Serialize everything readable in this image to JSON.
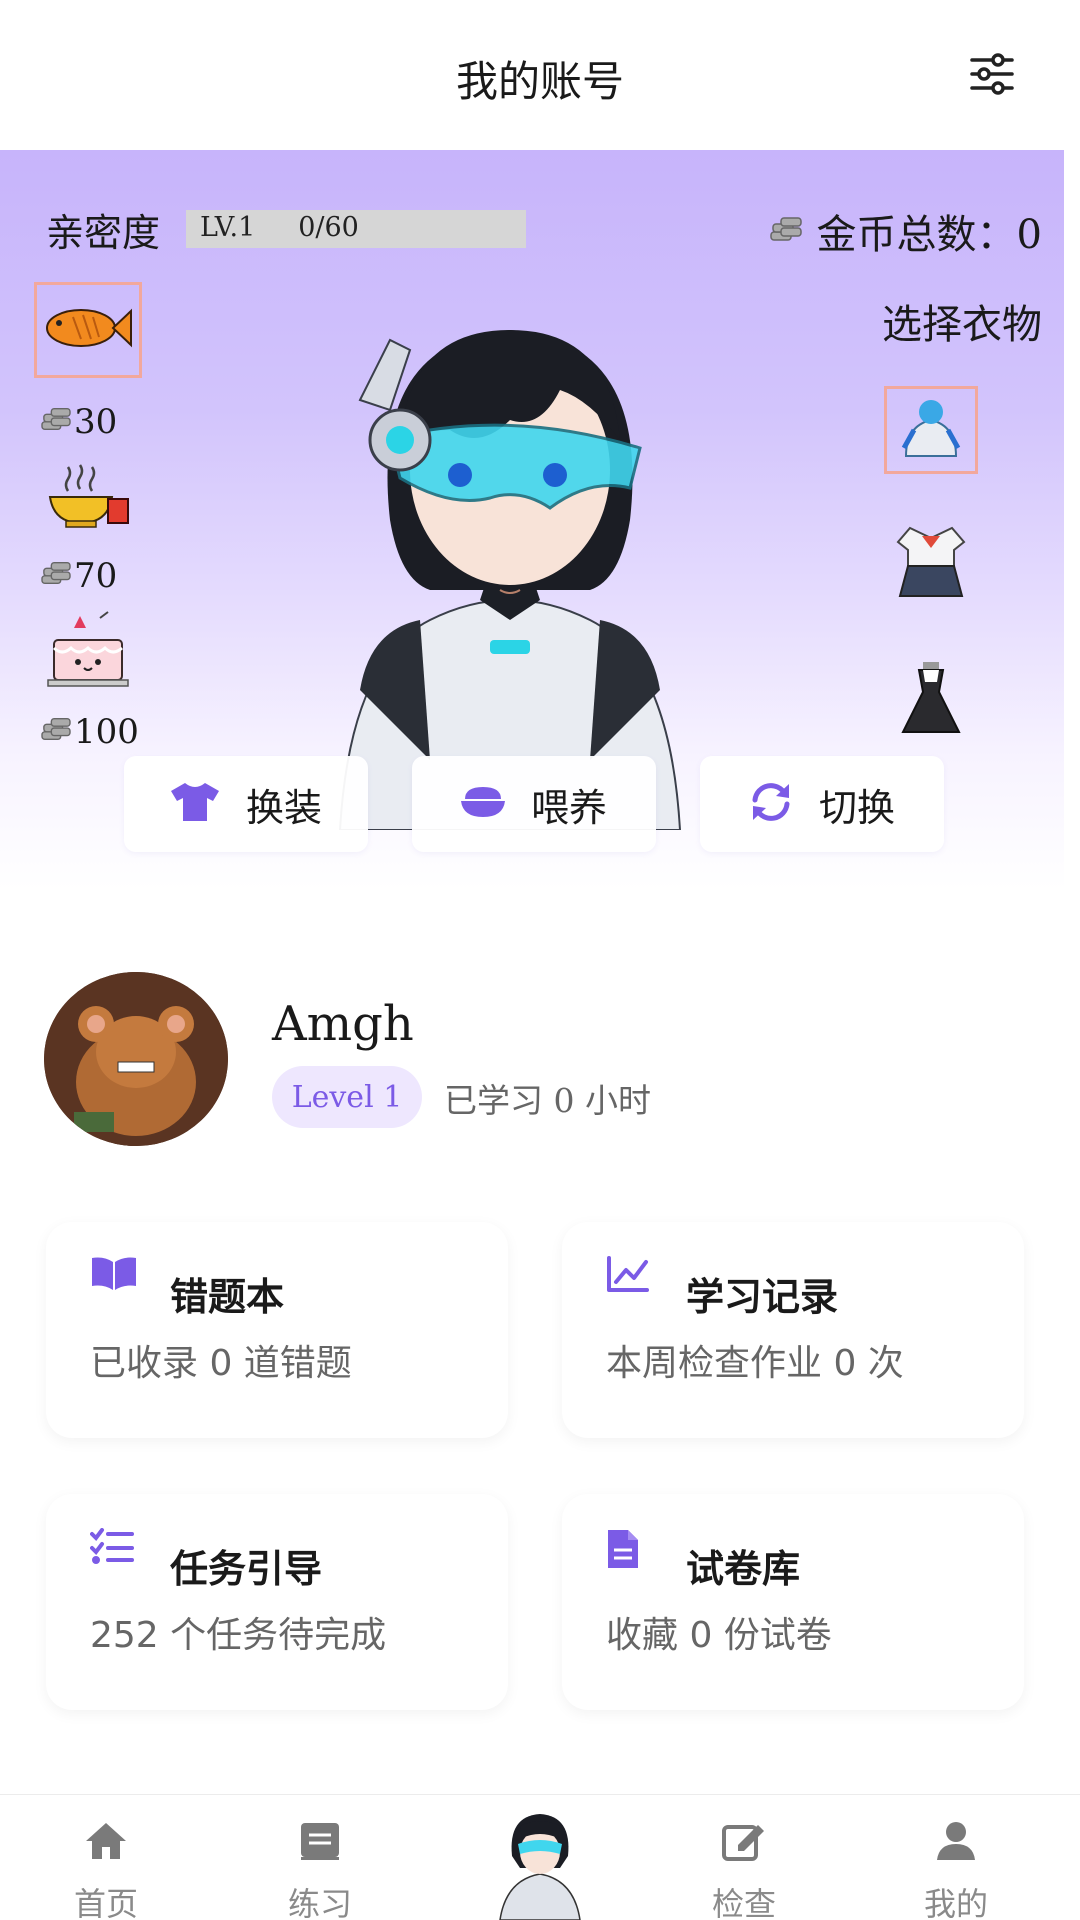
{
  "header": {
    "title": "我的账号",
    "settings_icon": "sliders-icon"
  },
  "hero": {
    "intimacy_label": "亲密度",
    "intimacy_level": "LV.1",
    "intimacy_progress": "0/60",
    "intimacy_fill_fraction": 0,
    "coins_label": "金币总数：",
    "coins_value": "0",
    "choose_clothes": "选择衣物",
    "foods": [
      {
        "icon": "fish-icon",
        "price": "30"
      },
      {
        "icon": "noodle-bowl-icon",
        "price": "70"
      },
      {
        "icon": "cake-icon",
        "price": "100"
      }
    ],
    "clothes": [
      {
        "icon": "mecha-suit-icon",
        "selected": true
      },
      {
        "icon": "sailor-uniform-icon",
        "selected": false
      },
      {
        "icon": "black-dress-icon",
        "selected": false
      }
    ],
    "actions": [
      {
        "icon": "shirt-icon",
        "label": "换装"
      },
      {
        "icon": "bowl-icon",
        "label": "喂养"
      },
      {
        "icon": "refresh-icon",
        "label": "切换"
      }
    ]
  },
  "profile": {
    "name": "Amgh",
    "level": "Level 1",
    "study_prefix": "已学习",
    "study_value": "0",
    "study_suffix": "小时"
  },
  "cards": [
    {
      "icon": "book-open-icon",
      "title": "错题本",
      "desc": "已收录 0 道错题"
    },
    {
      "icon": "chart-line-icon",
      "title": "学习记录",
      "desc": "本周检查作业 0 次"
    },
    {
      "icon": "task-list-icon",
      "title": "任务引导",
      "desc": "252 个任务待完成"
    },
    {
      "icon": "file-document-icon",
      "title": "试卷库",
      "desc": "收藏 0 份试卷"
    }
  ],
  "nav": [
    {
      "icon": "home-icon",
      "label": "首页"
    },
    {
      "icon": "book-icon",
      "label": "练习"
    },
    {
      "icon": "character-icon",
      "label": ""
    },
    {
      "icon": "edit-icon",
      "label": "检查"
    },
    {
      "icon": "user-icon",
      "label": "我的"
    }
  ],
  "colors": {
    "accent": "#7b5be6",
    "hero_top": "#c7b4fb",
    "text_muted": "#666666",
    "nav_icon": "#7a7a7a"
  }
}
